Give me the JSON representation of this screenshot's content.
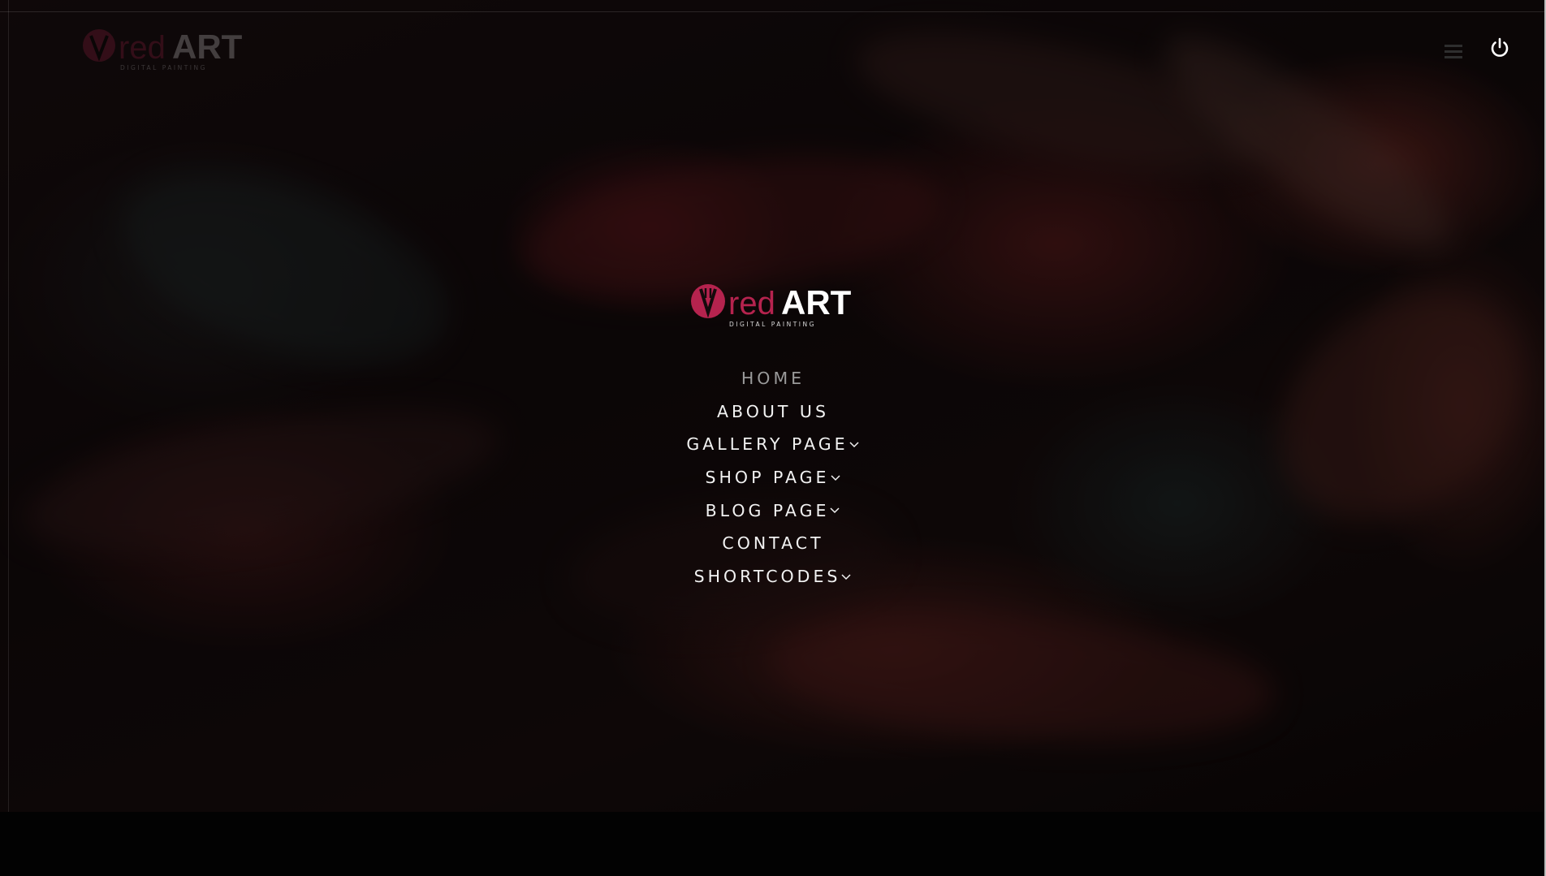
{
  "brand": {
    "name_part1": "red",
    "name_part2": "ART",
    "tagline": "DIGITAL PAINTING",
    "accent_color": "#b5234e"
  },
  "header": {
    "menu_icon": "hamburger-menu-icon",
    "power_icon": "power-icon"
  },
  "nav": {
    "items": [
      {
        "label": "HOME",
        "active": true,
        "has_submenu": false
      },
      {
        "label": "ABOUT US",
        "active": false,
        "has_submenu": false
      },
      {
        "label": "GALLERY PAGE",
        "active": false,
        "has_submenu": true
      },
      {
        "label": "SHOP PAGE",
        "active": false,
        "has_submenu": true
      },
      {
        "label": "BLOG PAGE",
        "active": false,
        "has_submenu": true
      },
      {
        "label": "CONTACT",
        "active": false,
        "has_submenu": false
      },
      {
        "label": "SHORTCODES",
        "active": false,
        "has_submenu": true
      }
    ],
    "submenu_icon": "chevron-down-icon",
    "text_color": "#f2f2f2",
    "active_color": "#9a9a9a"
  }
}
